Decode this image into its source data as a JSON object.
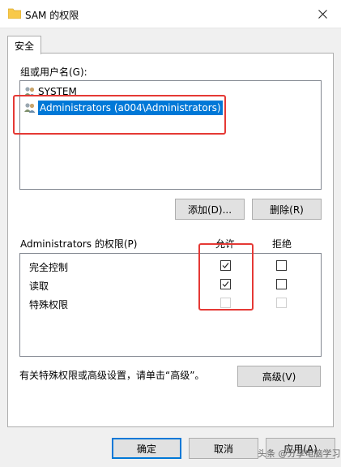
{
  "window": {
    "title": "SAM 的权限"
  },
  "tabs": [
    {
      "label": "安全"
    }
  ],
  "users": {
    "label": "组或用户名(G):",
    "items": [
      {
        "name": "SYSTEM",
        "selected": false
      },
      {
        "name": "Administrators (a004\\Administrators)",
        "selected": true
      }
    ]
  },
  "buttons": {
    "add": "添加(D)...",
    "remove": "删除(R)",
    "advanced": "高级(V)",
    "ok": "确定",
    "cancel": "取消",
    "apply": "应用(A)"
  },
  "permissions": {
    "label": "Administrators 的权限(P)",
    "allow_header": "允许",
    "deny_header": "拒绝",
    "rows": [
      {
        "name": "完全控制",
        "allow": true,
        "deny": false,
        "disabled": false
      },
      {
        "name": "读取",
        "allow": true,
        "deny": false,
        "disabled": false
      },
      {
        "name": "特殊权限",
        "allow": false,
        "deny": false,
        "disabled": true
      }
    ]
  },
  "note": "有关特殊权限或高级设置，请单击“高级”。",
  "watermark": "头条 @分享电脑学习",
  "colors": {
    "selection": "#0078d7",
    "annotation": "#e53935"
  }
}
